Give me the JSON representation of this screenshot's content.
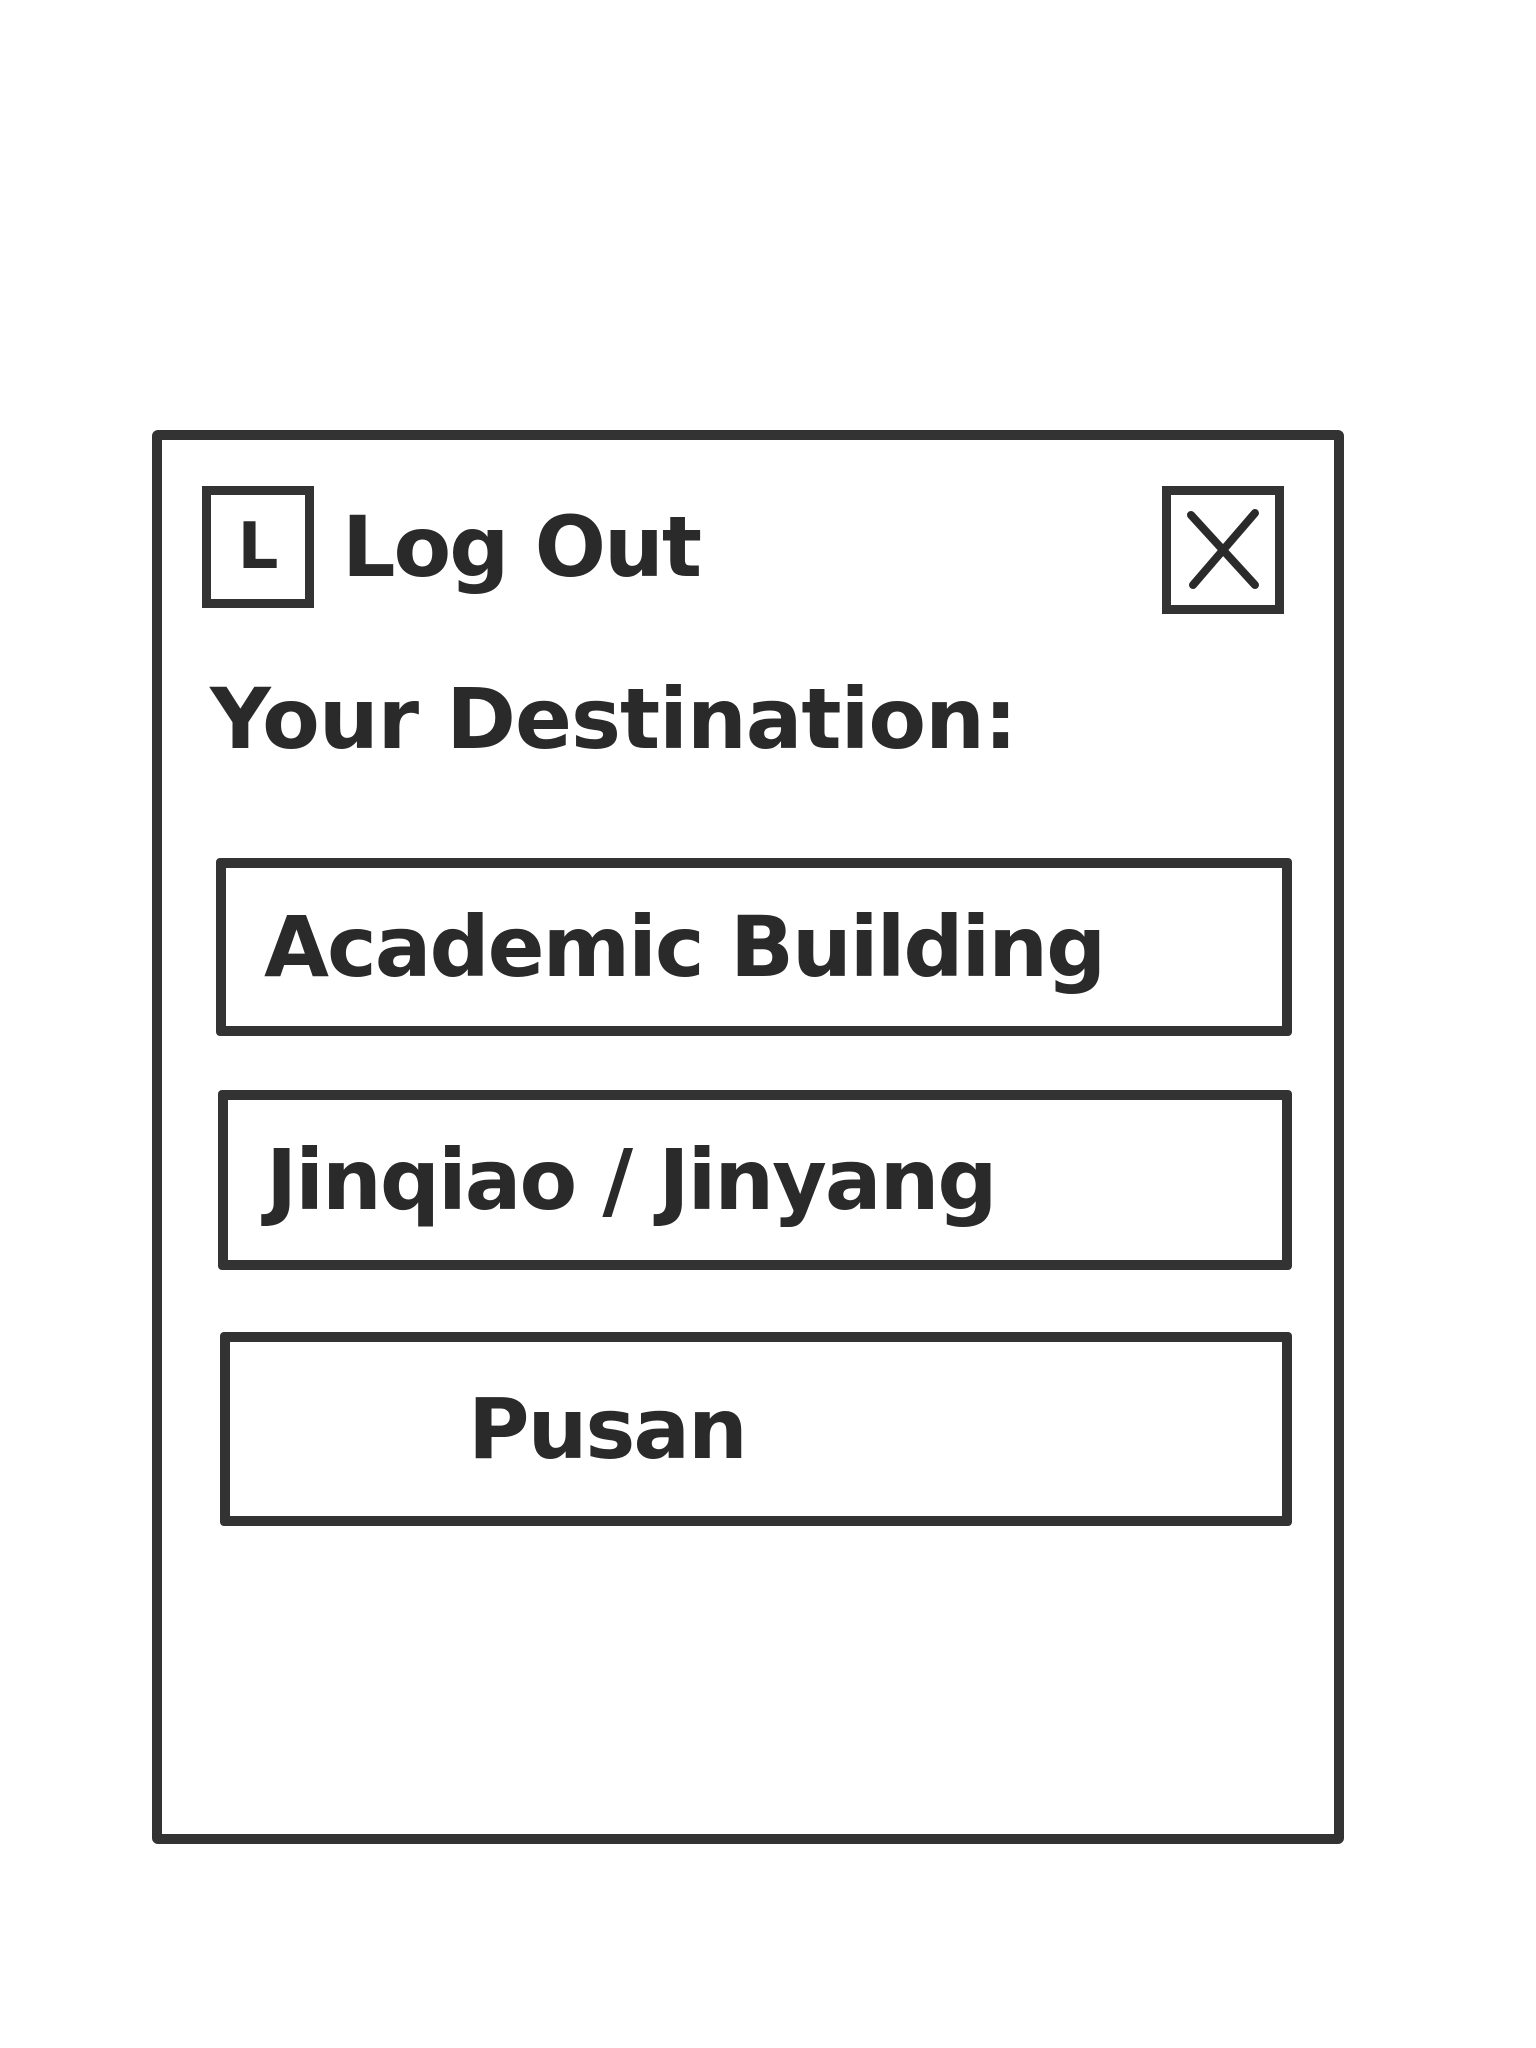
{
  "header": {
    "logout_icon_letter": "L",
    "logout_icon": "logout-icon",
    "logout_label": "Log Out",
    "close_icon": "close-icon"
  },
  "destination": {
    "heading": "Your Destination:",
    "options": [
      {
        "label": "Academic Building"
      },
      {
        "label": "Jinqiao / Jinyang"
      },
      {
        "label": "Pusan"
      }
    ]
  },
  "colors": {
    "stroke": "#333333",
    "background": "#ffffff"
  }
}
